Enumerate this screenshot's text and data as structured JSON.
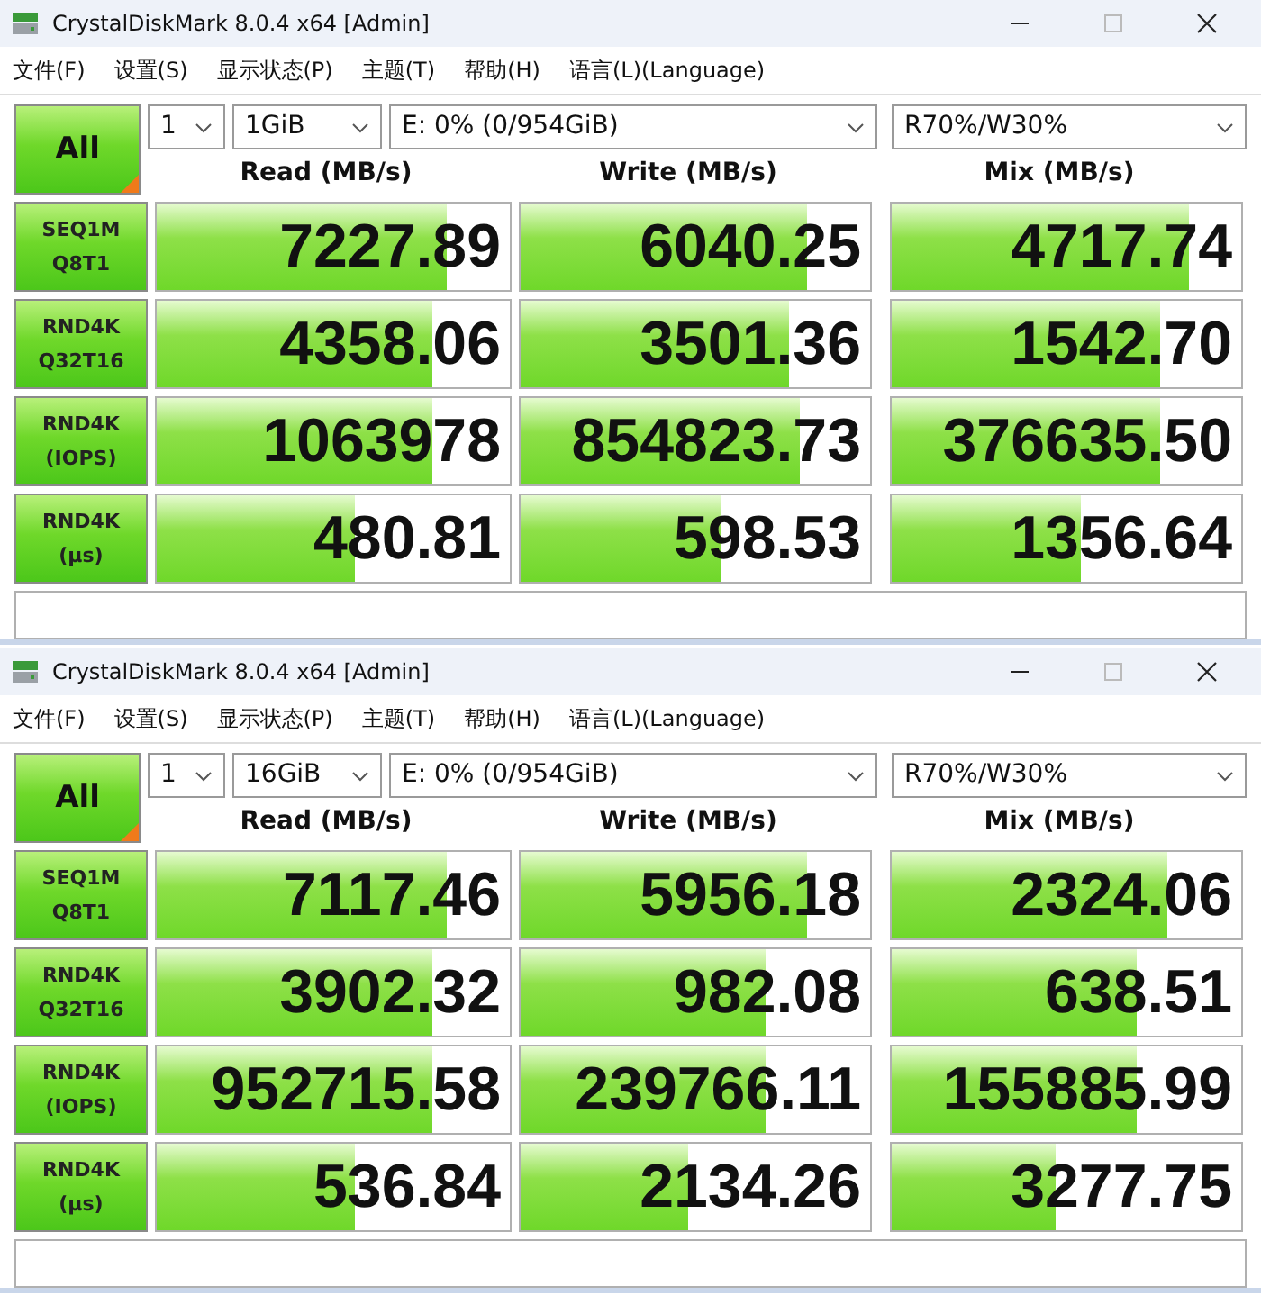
{
  "windows": [
    {
      "title": "CrystalDiskMark 8.0.4 x64 [Admin]",
      "menu": [
        "文件(F)",
        "设置(S)",
        "显示状态(P)",
        "主题(T)",
        "帮助(H)",
        "语言(L)(Language)"
      ],
      "all_button": "All",
      "count": "1",
      "size": "1GiB",
      "drive": "E: 0% (0/954GiB)",
      "mode": "R70%/W30%",
      "headers": [
        "Read (MB/s)",
        "Write (MB/s)",
        "Mix (MB/s)"
      ],
      "rows": [
        {
          "test": "SEQ1M",
          "param": "Q8T1",
          "cells": [
            {
              "value": "7227.89",
              "level": 0.82
            },
            {
              "value": "6040.25",
              "level": 0.82
            },
            {
              "value": "4717.74",
              "level": 0.85
            }
          ]
        },
        {
          "test": "RND4K",
          "param": "Q32T16",
          "cells": [
            {
              "value": "4358.06",
              "level": 0.78
            },
            {
              "value": "3501.36",
              "level": 0.77
            },
            {
              "value": "1542.70",
              "level": 0.77
            }
          ]
        },
        {
          "test": "RND4K",
          "param": "(IOPS)",
          "cells": [
            {
              "value": "1063978",
              "level": 0.78
            },
            {
              "value": "854823.73",
              "level": 0.8
            },
            {
              "value": "376635.50",
              "level": 0.77
            }
          ]
        },
        {
          "test": "RND4K",
          "param": "(µs)",
          "cells": [
            {
              "value": "480.81",
              "level": 0.56
            },
            {
              "value": "598.53",
              "level": 0.57
            },
            {
              "value": "1356.64",
              "level": 0.54
            }
          ]
        }
      ]
    },
    {
      "title": "CrystalDiskMark 8.0.4 x64 [Admin]",
      "menu": [
        "文件(F)",
        "设置(S)",
        "显示状态(P)",
        "主题(T)",
        "帮助(H)",
        "语言(L)(Language)"
      ],
      "all_button": "All",
      "count": "1",
      "size": "16GiB",
      "drive": "E: 0% (0/954GiB)",
      "mode": "R70%/W30%",
      "headers": [
        "Read (MB/s)",
        "Write (MB/s)",
        "Mix (MB/s)"
      ],
      "rows": [
        {
          "test": "SEQ1M",
          "param": "Q8T1",
          "cells": [
            {
              "value": "7117.46",
              "level": 0.82
            },
            {
              "value": "5956.18",
              "level": 0.82
            },
            {
              "value": "2324.06",
              "level": 0.79
            }
          ]
        },
        {
          "test": "RND4K",
          "param": "Q32T16",
          "cells": [
            {
              "value": "3902.32",
              "level": 0.78
            },
            {
              "value": "982.08",
              "level": 0.7
            },
            {
              "value": "638.51",
              "level": 0.7
            }
          ]
        },
        {
          "test": "RND4K",
          "param": "(IOPS)",
          "cells": [
            {
              "value": "952715.58",
              "level": 0.78
            },
            {
              "value": "239766.11",
              "level": 0.7
            },
            {
              "value": "155885.99",
              "level": 0.7
            }
          ]
        },
        {
          "test": "RND4K",
          "param": "(µs)",
          "cells": [
            {
              "value": "536.84",
              "level": 0.56
            },
            {
              "value": "2134.26",
              "level": 0.48
            },
            {
              "value": "3277.75",
              "level": 0.47
            }
          ]
        }
      ]
    }
  ]
}
